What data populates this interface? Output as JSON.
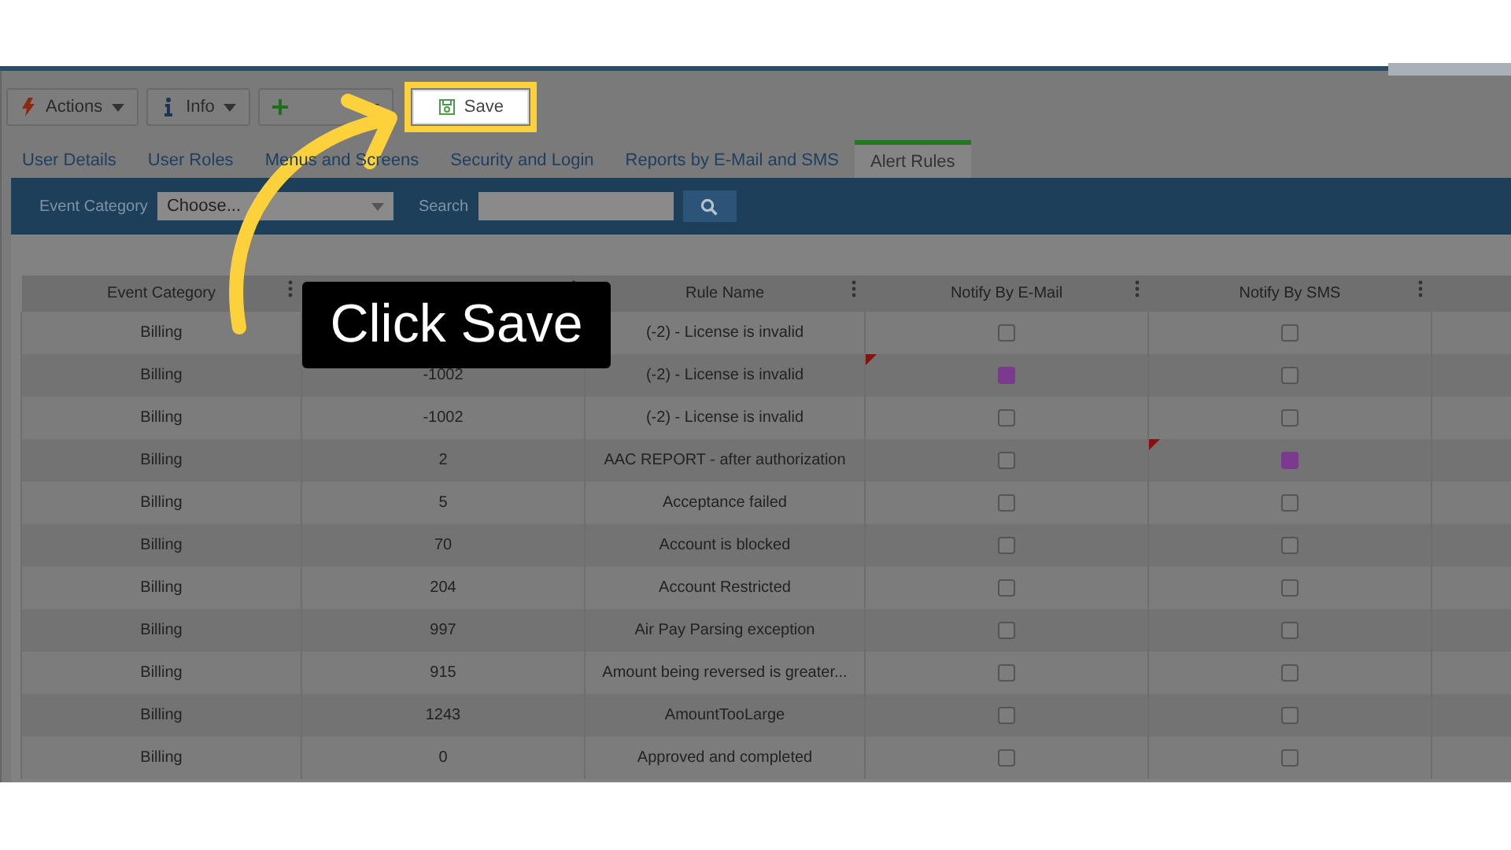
{
  "toolbar": {
    "buttons": [
      {
        "kind": "actions",
        "label": "Actions"
      },
      {
        "kind": "info",
        "label": "Info"
      },
      {
        "kind": "create"
      }
    ],
    "save": {
      "label": "Save",
      "highlighted": true
    }
  },
  "tabs": [
    {
      "label": "User Details",
      "selected": false
    },
    {
      "label": "User Roles",
      "selected": false
    },
    {
      "label": "Menus and Screens",
      "selected": false
    },
    {
      "label": "Security and Login",
      "selected": false
    },
    {
      "label": "Reports by E-Mail and SMS",
      "selected": false
    },
    {
      "label": "Alert Rules",
      "selected": true
    }
  ],
  "filter": {
    "category_label": "Event Category",
    "category_value": "Choose...",
    "search_label": "Search"
  },
  "table": {
    "columns": [
      {
        "title": "Event Category"
      },
      {},
      {
        "title": "Rule Name"
      },
      {
        "title": "Notify By E-Mail"
      },
      {
        "title": "Notify By SMS"
      }
    ],
    "rows": [
      {
        "category": "Billing",
        "code": "",
        "rule": "(-2) - License is invalid",
        "email": {
          "checked": false,
          "changed": false
        },
        "sms": {
          "checked": false,
          "changed": false
        }
      },
      {
        "category": "Billing",
        "code": "-1002",
        "rule": "(-2) - License is invalid",
        "email": {
          "checked": true,
          "changed": true
        },
        "sms": {
          "checked": false,
          "changed": false
        }
      },
      {
        "category": "Billing",
        "code": "-1002",
        "rule": "(-2) - License is invalid",
        "email": {
          "checked": false,
          "changed": false
        },
        "sms": {
          "checked": false,
          "changed": false
        }
      },
      {
        "category": "Billing",
        "code": "2",
        "rule": "AAC REPORT - after authorization",
        "email": {
          "checked": false,
          "changed": false
        },
        "sms": {
          "checked": true,
          "changed": true
        }
      },
      {
        "category": "Billing",
        "code": "5",
        "rule": "Acceptance failed",
        "email": {
          "checked": false,
          "changed": false
        },
        "sms": {
          "checked": false,
          "changed": false
        }
      },
      {
        "category": "Billing",
        "code": "70",
        "rule": "Account is blocked",
        "email": {
          "checked": false,
          "changed": false
        },
        "sms": {
          "checked": false,
          "changed": false
        }
      },
      {
        "category": "Billing",
        "code": "204",
        "rule": "Account Restricted",
        "email": {
          "checked": false,
          "changed": false
        },
        "sms": {
          "checked": false,
          "changed": false
        }
      },
      {
        "category": "Billing",
        "code": "997",
        "rule": "Air Pay Parsing exception",
        "email": {
          "checked": false,
          "changed": false
        },
        "sms": {
          "checked": false,
          "changed": false
        }
      },
      {
        "category": "Billing",
        "code": "915",
        "rule": "Amount being reversed is greater...",
        "email": {
          "checked": false,
          "changed": false
        },
        "sms": {
          "checked": false,
          "changed": false
        }
      },
      {
        "category": "Billing",
        "code": "1243",
        "rule": "AmountTooLarge",
        "email": {
          "checked": false,
          "changed": false
        },
        "sms": {
          "checked": false,
          "changed": false
        }
      },
      {
        "category": "Billing",
        "code": "0",
        "rule": "Approved and completed",
        "email": {
          "checked": false,
          "changed": false
        },
        "sms": {
          "checked": false,
          "changed": false
        }
      }
    ]
  },
  "callout": {
    "text": "Click Save"
  }
}
